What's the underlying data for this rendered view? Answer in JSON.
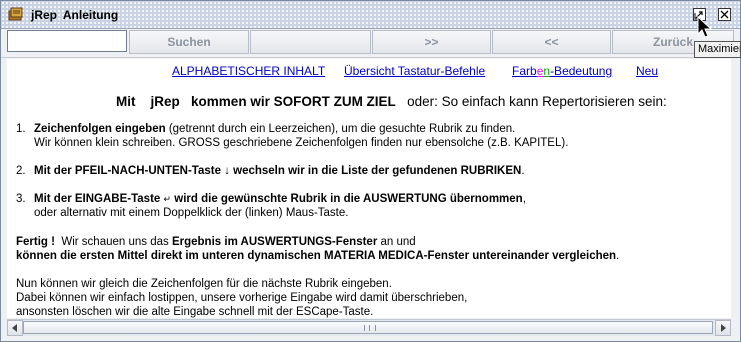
{
  "window": {
    "title": "jRep  Anleitung",
    "tooltip": "Maximieren"
  },
  "toolbar": {
    "search_value": "",
    "buttons": {
      "search": "Suchen",
      "blank": "",
      "forward": ">>",
      "back": "<<",
      "return": "Zurück"
    }
  },
  "links": {
    "alphabetic": "ALPHABETISCHER INHALT",
    "keyboard": "Übersicht Tastatur-Befehle",
    "color_prefix": "Farb",
    "color_suffix": "-Bedeutung",
    "color_letters": [
      "e",
      "n"
    ],
    "new": "Neu"
  },
  "heading": {
    "with": "Mit",
    "jrep": "jRep",
    "main": "kommen wir SOFORT ZUM ZIEL",
    "rest": "oder: So einfach kann Repertorisieren sein:"
  },
  "steps": [
    {
      "num": "1.",
      "bold": "Zeichenfolgen eingeben",
      "text": " (getrennt durch ein Leerzeichen), um die gesuchte Rubrik zu finden.",
      "line2": "Wir können klein schreiben. GROSS geschriebene Zeichenfolgen finden nur ebensolche (z.B. KAPITEL)."
    },
    {
      "num": "2.",
      "bold": "Mit der PFEIL-NACH-UNTEN-Taste",
      "symbol": "↓",
      "bold2": " wechseln wir in die Liste der gefundenen RUBRIKEN",
      "text": "."
    },
    {
      "num": "3.",
      "bold": "Mit der EINGABE-Taste",
      "symbol": "↵",
      "bold2": " wird die gewünschte Rubrik in die AUSWERTUNG übernommen",
      "text": ",",
      "line2": "oder alternativ mit einem Doppelklick der (linken) Maus-Taste."
    }
  ],
  "fertig": {
    "bold": "Fertig !",
    "text1": "  Wir schauen uns das ",
    "bold2": "Ergebnis im AUSWERTUNGS-Fenster",
    "text2": " an und",
    "line2": "können die ersten Mittel direkt im unteren dynamischen MATERIA MEDICA-Fenster untereinander vergleichen",
    "line2_end": "."
  },
  "closing": [
    "Nun können wir gleich die Zeichenfolgen für die nächste Rubrik eingeben.",
    "Dabei können wir einfach lostippen, unsere vorherige Eingabe wird damit überschrieben,",
    "ansonsten löschen wir die alte Eingabe schnell mit der ESCape-Taste."
  ],
  "colors": {
    "link": "#0000cc",
    "disabled_text": "#8b94a0",
    "rainbow": [
      "#ff00ff",
      "#00aa00"
    ]
  },
  "icons": [
    "app-icon",
    "maximize-icon",
    "close-icon",
    "scroll-left-icon",
    "scroll-right-icon",
    "mouse-cursor-icon"
  ]
}
